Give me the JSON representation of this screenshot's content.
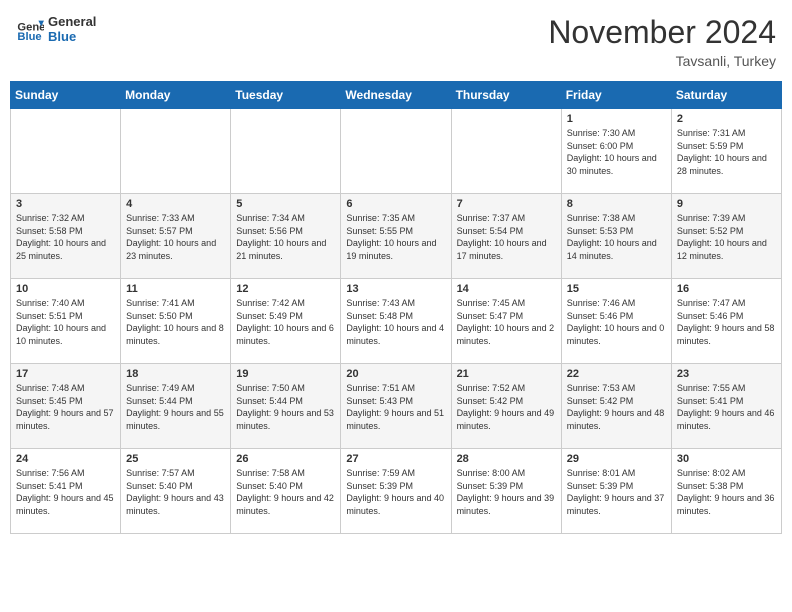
{
  "header": {
    "logo_line1": "General",
    "logo_line2": "Blue",
    "month": "November 2024",
    "location": "Tavsanli, Turkey"
  },
  "days_of_week": [
    "Sunday",
    "Monday",
    "Tuesday",
    "Wednesday",
    "Thursday",
    "Friday",
    "Saturday"
  ],
  "weeks": [
    [
      {
        "day": "",
        "info": ""
      },
      {
        "day": "",
        "info": ""
      },
      {
        "day": "",
        "info": ""
      },
      {
        "day": "",
        "info": ""
      },
      {
        "day": "",
        "info": ""
      },
      {
        "day": "1",
        "info": "Sunrise: 7:30 AM\nSunset: 6:00 PM\nDaylight: 10 hours and 30 minutes."
      },
      {
        "day": "2",
        "info": "Sunrise: 7:31 AM\nSunset: 5:59 PM\nDaylight: 10 hours and 28 minutes."
      }
    ],
    [
      {
        "day": "3",
        "info": "Sunrise: 7:32 AM\nSunset: 5:58 PM\nDaylight: 10 hours and 25 minutes."
      },
      {
        "day": "4",
        "info": "Sunrise: 7:33 AM\nSunset: 5:57 PM\nDaylight: 10 hours and 23 minutes."
      },
      {
        "day": "5",
        "info": "Sunrise: 7:34 AM\nSunset: 5:56 PM\nDaylight: 10 hours and 21 minutes."
      },
      {
        "day": "6",
        "info": "Sunrise: 7:35 AM\nSunset: 5:55 PM\nDaylight: 10 hours and 19 minutes."
      },
      {
        "day": "7",
        "info": "Sunrise: 7:37 AM\nSunset: 5:54 PM\nDaylight: 10 hours and 17 minutes."
      },
      {
        "day": "8",
        "info": "Sunrise: 7:38 AM\nSunset: 5:53 PM\nDaylight: 10 hours and 14 minutes."
      },
      {
        "day": "9",
        "info": "Sunrise: 7:39 AM\nSunset: 5:52 PM\nDaylight: 10 hours and 12 minutes."
      }
    ],
    [
      {
        "day": "10",
        "info": "Sunrise: 7:40 AM\nSunset: 5:51 PM\nDaylight: 10 hours and 10 minutes."
      },
      {
        "day": "11",
        "info": "Sunrise: 7:41 AM\nSunset: 5:50 PM\nDaylight: 10 hours and 8 minutes."
      },
      {
        "day": "12",
        "info": "Sunrise: 7:42 AM\nSunset: 5:49 PM\nDaylight: 10 hours and 6 minutes."
      },
      {
        "day": "13",
        "info": "Sunrise: 7:43 AM\nSunset: 5:48 PM\nDaylight: 10 hours and 4 minutes."
      },
      {
        "day": "14",
        "info": "Sunrise: 7:45 AM\nSunset: 5:47 PM\nDaylight: 10 hours and 2 minutes."
      },
      {
        "day": "15",
        "info": "Sunrise: 7:46 AM\nSunset: 5:46 PM\nDaylight: 10 hours and 0 minutes."
      },
      {
        "day": "16",
        "info": "Sunrise: 7:47 AM\nSunset: 5:46 PM\nDaylight: 9 hours and 58 minutes."
      }
    ],
    [
      {
        "day": "17",
        "info": "Sunrise: 7:48 AM\nSunset: 5:45 PM\nDaylight: 9 hours and 57 minutes."
      },
      {
        "day": "18",
        "info": "Sunrise: 7:49 AM\nSunset: 5:44 PM\nDaylight: 9 hours and 55 minutes."
      },
      {
        "day": "19",
        "info": "Sunrise: 7:50 AM\nSunset: 5:44 PM\nDaylight: 9 hours and 53 minutes."
      },
      {
        "day": "20",
        "info": "Sunrise: 7:51 AM\nSunset: 5:43 PM\nDaylight: 9 hours and 51 minutes."
      },
      {
        "day": "21",
        "info": "Sunrise: 7:52 AM\nSunset: 5:42 PM\nDaylight: 9 hours and 49 minutes."
      },
      {
        "day": "22",
        "info": "Sunrise: 7:53 AM\nSunset: 5:42 PM\nDaylight: 9 hours and 48 minutes."
      },
      {
        "day": "23",
        "info": "Sunrise: 7:55 AM\nSunset: 5:41 PM\nDaylight: 9 hours and 46 minutes."
      }
    ],
    [
      {
        "day": "24",
        "info": "Sunrise: 7:56 AM\nSunset: 5:41 PM\nDaylight: 9 hours and 45 minutes."
      },
      {
        "day": "25",
        "info": "Sunrise: 7:57 AM\nSunset: 5:40 PM\nDaylight: 9 hours and 43 minutes."
      },
      {
        "day": "26",
        "info": "Sunrise: 7:58 AM\nSunset: 5:40 PM\nDaylight: 9 hours and 42 minutes."
      },
      {
        "day": "27",
        "info": "Sunrise: 7:59 AM\nSunset: 5:39 PM\nDaylight: 9 hours and 40 minutes."
      },
      {
        "day": "28",
        "info": "Sunrise: 8:00 AM\nSunset: 5:39 PM\nDaylight: 9 hours and 39 minutes."
      },
      {
        "day": "29",
        "info": "Sunrise: 8:01 AM\nSunset: 5:39 PM\nDaylight: 9 hours and 37 minutes."
      },
      {
        "day": "30",
        "info": "Sunrise: 8:02 AM\nSunset: 5:38 PM\nDaylight: 9 hours and 36 minutes."
      }
    ]
  ]
}
